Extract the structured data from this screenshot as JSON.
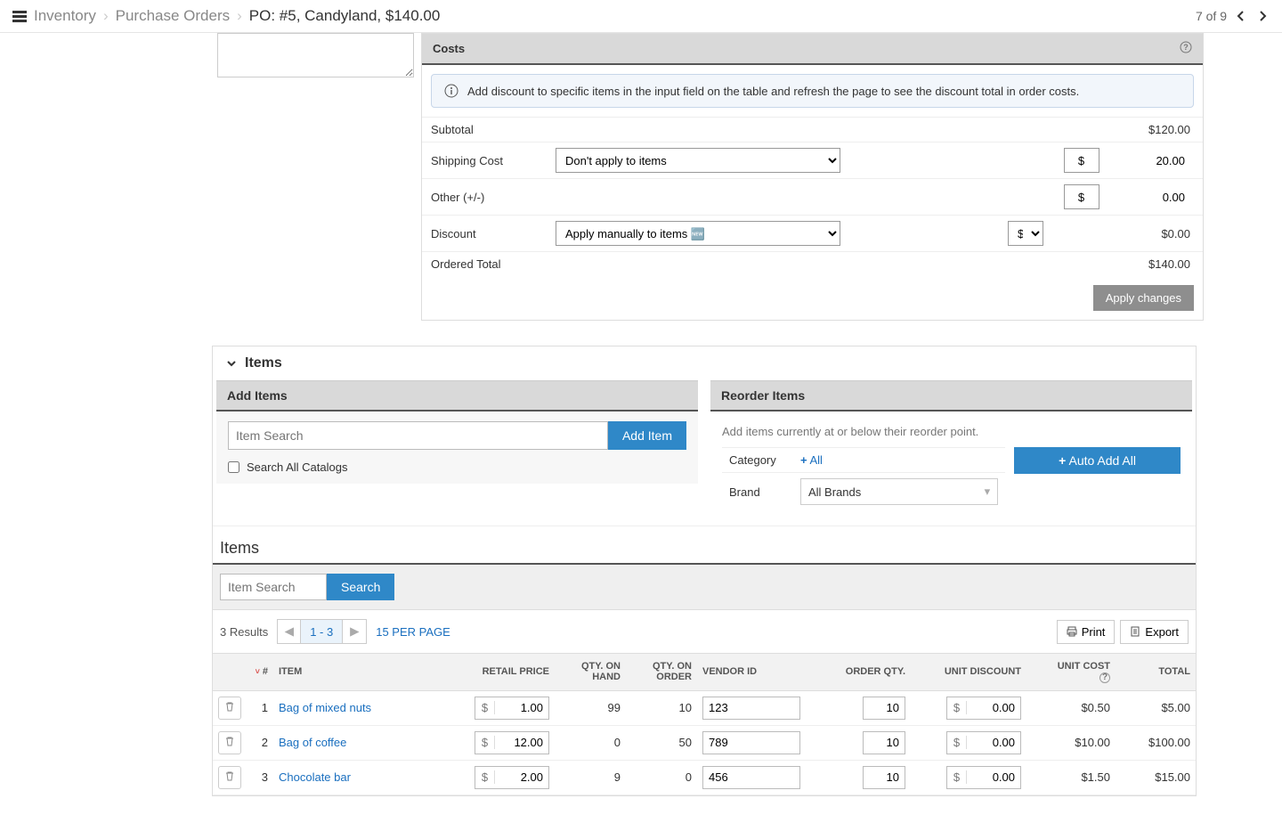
{
  "breadcrumb": {
    "l1": "Inventory",
    "l2": "Purchase Orders",
    "current": "PO: #5, Candyland, $140.00"
  },
  "pager": {
    "position": "7 of 9"
  },
  "costs": {
    "header": "Costs",
    "info": "Add discount to specific items in the input field on the table and refresh the page to see the discount total in order costs.",
    "subtotal_label": "Subtotal",
    "subtotal_value": "$120.00",
    "shipping_label": "Shipping Cost",
    "shipping_select": "Don't apply to items",
    "shipping_curr": "$",
    "shipping_value": "20.00",
    "other_label": "Other (+/-)",
    "other_curr": "$",
    "other_value": "0.00",
    "discount_label": "Discount",
    "discount_select": "Apply manually to items",
    "discount_new_badge": "NEW",
    "discount_unit": "$",
    "discount_value": "$0.00",
    "total_label": "Ordered Total",
    "total_value": "$140.00",
    "apply_btn": "Apply changes"
  },
  "items_section": {
    "header": "Items",
    "add_items": {
      "header": "Add Items",
      "search_placeholder": "Item Search",
      "add_btn": "Add Item",
      "checkbox_label": "Search All Catalogs"
    },
    "reorder": {
      "header": "Reorder Items",
      "help": "Add items currently at or below their reorder point.",
      "category_label": "Category",
      "category_all": "All",
      "brand_label": "Brand",
      "brand_value": "All Brands",
      "auto_add_btn": "Auto Add All"
    }
  },
  "items_list": {
    "title": "Items",
    "search_placeholder": "Item Search",
    "search_btn": "Search",
    "results_text": "3 Results",
    "range": "1 - 3",
    "per_page": "15 PER PAGE",
    "print_btn": "Print",
    "export_btn": "Export",
    "columns": {
      "num": "#",
      "item": "ITEM",
      "retail": "RETAIL PRICE",
      "onhand": "QTY. ON HAND",
      "onorder": "QTY. ON ORDER",
      "vendor": "VENDOR ID",
      "orderqty": "ORDER QTY.",
      "discount": "UNIT DISCOUNT",
      "unitcost": "UNIT COST",
      "total": "TOTAL"
    },
    "rows": [
      {
        "num": "1",
        "item": "Bag of mixed nuts",
        "retail": "1.00",
        "onhand": "99",
        "onorder": "10",
        "vendor": "123",
        "qty": "10",
        "discount": "0.00",
        "unitcost": "$0.50",
        "total": "$5.00"
      },
      {
        "num": "2",
        "item": "Bag of coffee",
        "retail": "12.00",
        "onhand": "0",
        "onorder": "50",
        "vendor": "789",
        "qty": "10",
        "discount": "0.00",
        "unitcost": "$10.00",
        "total": "$100.00"
      },
      {
        "num": "3",
        "item": "Chocolate bar",
        "retail": "2.00",
        "onhand": "9",
        "onorder": "0",
        "vendor": "456",
        "qty": "10",
        "discount": "0.00",
        "unitcost": "$1.50",
        "total": "$15.00"
      }
    ]
  }
}
